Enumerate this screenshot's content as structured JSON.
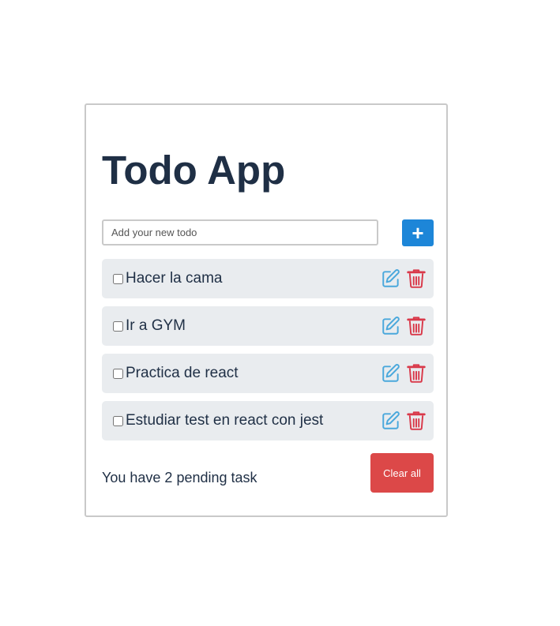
{
  "app": {
    "title": "Todo App"
  },
  "new_todo": {
    "placeholder": "Add your new todo",
    "value": "",
    "add_label": "+"
  },
  "todos": [
    {
      "text": "Hacer la cama",
      "done": false
    },
    {
      "text": "Ir a GYM",
      "done": false
    },
    {
      "text": "Practica de react",
      "done": false
    },
    {
      "text": "Estudiar test en react con jest",
      "done": false
    }
  ],
  "footer": {
    "pending_prefix": "You have ",
    "pending_count": "2",
    "pending_suffix": " pending task",
    "clear_label": "Clear all"
  },
  "icons": {
    "edit": "edit-icon",
    "delete": "trash-icon"
  },
  "colors": {
    "accent": "#1d86d8",
    "danger": "#dc4848",
    "edit_icon": "#4aa8dc",
    "delete_icon": "#d9394a",
    "text": "#1f2f45",
    "item_bg": "#e9ecef"
  }
}
